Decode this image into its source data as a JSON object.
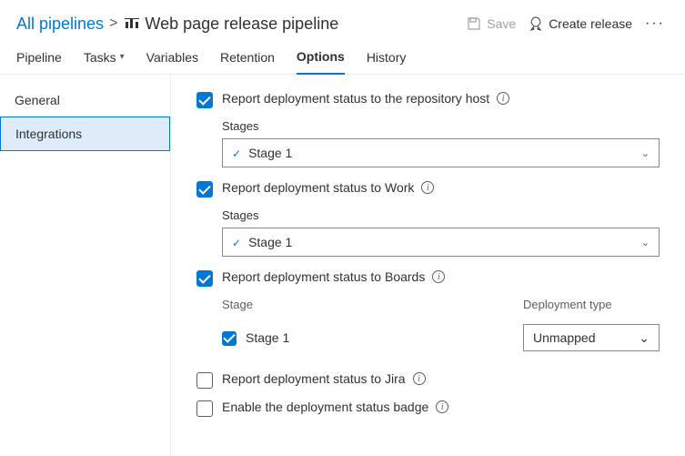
{
  "breadcrumb": {
    "root": "All pipelines",
    "title": "Web page release pipeline"
  },
  "actions": {
    "save": "Save",
    "create_release": "Create release"
  },
  "tabs": {
    "pipeline": "Pipeline",
    "tasks": "Tasks",
    "variables": "Variables",
    "retention": "Retention",
    "options": "Options",
    "history": "History"
  },
  "sidebar": {
    "general": "General",
    "integrations": "Integrations"
  },
  "options": {
    "repo_host": {
      "label": "Report deployment status to the repository host",
      "stages_label": "Stages",
      "stage_value": "Stage 1"
    },
    "work": {
      "label": "Report deployment status to Work",
      "stages_label": "Stages",
      "stage_value": "Stage 1"
    },
    "boards": {
      "label": "Report deployment status to Boards",
      "col_stage": "Stage",
      "col_deploy_type": "Deployment type",
      "stage_value": "Stage 1",
      "deploy_type_value": "Unmapped"
    },
    "jira": {
      "label": "Report deployment status to Jira"
    },
    "badge": {
      "label": "Enable the deployment status badge"
    }
  }
}
